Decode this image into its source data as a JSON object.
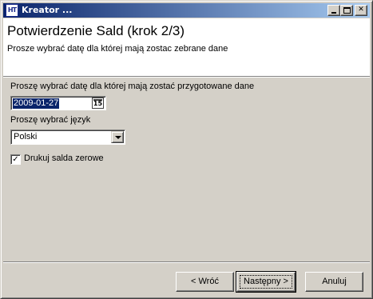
{
  "window": {
    "title": "Kreator ...",
    "icon_text": "HT",
    "icon": "app-icon"
  },
  "header": {
    "title": "Potwierdzenie Sald (krok 2/3)",
    "subtitle": "Prosze wybrać datę dla której mają zostac zebrane dane"
  },
  "form": {
    "date_label": "Proszę wybrać datę dla której mają zostać przygotowane dane",
    "date_value": "2009-01-27",
    "calendar_icon_text": "15",
    "language_label": "Proszę wybrać język",
    "language_value": "Polski",
    "zero_balances_label": "Drukuj salda zerowe",
    "zero_balances_checked": true
  },
  "buttons": {
    "back": "< Wróć",
    "next": "Następny >",
    "cancel": "Anuluj"
  },
  "colors": {
    "titlebar_start": "#0a246a",
    "titlebar_end": "#a6caf0",
    "window_bg": "#d4d0c8",
    "selection": "#0a246a"
  }
}
